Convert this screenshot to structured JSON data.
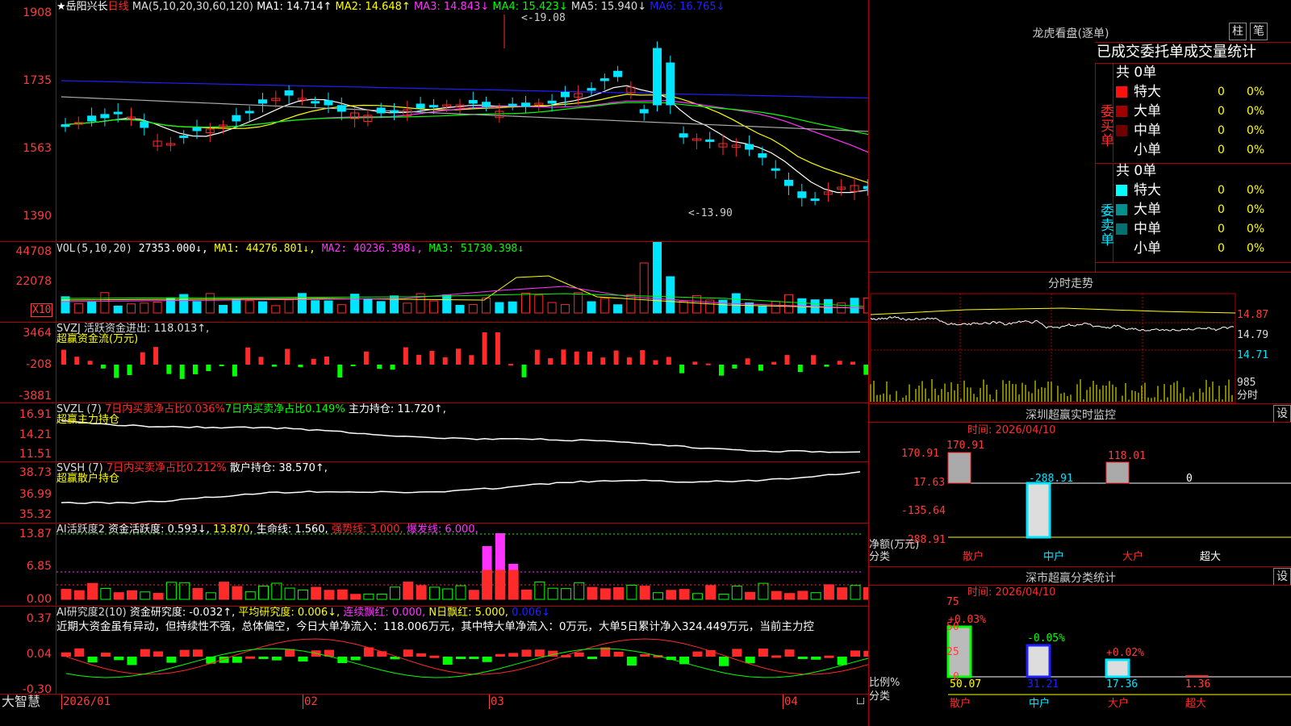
{
  "colors": {
    "up": "#ff2a2a",
    "down": "#00e5ff",
    "ma1": "#ffffff",
    "ma2": "#ffff00",
    "ma3": "#ff33ff",
    "ma4": "#00ff00",
    "ma5": "#aaaaaa",
    "ma6": "#2020ff",
    "grid": "#b00000",
    "vol_ma3": "#00ff00"
  },
  "header": {
    "stock_name": "★岳阳兴长",
    "period": "日线",
    "ma_label": "MA(5,10,20,30,60,120)",
    "ma1": "MA1: 14.714↑",
    "ma2": "MA2: 14.648↑",
    "ma3": "MA3: 14.843↓",
    "ma4": "MA4: 15.423↓",
    "ma5": "MA5: 15.940↓",
    "ma6": "MA6: 16.765↓"
  },
  "price_axis": [
    "1908",
    "1735",
    "1563",
    "1390"
  ],
  "price_annotations": {
    "high": "19.08",
    "low": "13.90"
  },
  "vol": {
    "label": "VOL(5,10,20)",
    "value": "27353.000↓,",
    "ma1": "MA1: 44276.801↓,",
    "ma2": "MA2: 40236.398↓,",
    "ma3": "MA3: 51730.398↓",
    "axis": [
      "44708",
      "22078"
    ],
    "unit": "X10"
  },
  "svzj": {
    "label": "SVZJ  活跃资金进出: 118.013↑,",
    "sub": "超赢资金流(万元)",
    "axis": [
      "3464",
      "-208",
      "-3881"
    ]
  },
  "svzl": {
    "label": "SVZL (7)",
    "t1": "7日内买卖净占比0.036%",
    "t2": "7日内买卖净占比0.149%",
    "t3": "主力持仓: 11.720↑,",
    "sub": "超赢主力持仓",
    "axis": [
      "16.91",
      "14.21",
      "11.51"
    ]
  },
  "svsh": {
    "label": "SVSH (7)",
    "t1": "7日内买卖净占比0.212%",
    "t2": "散户持仓: 38.570↑,",
    "sub": "超赢散户持仓",
    "axis": [
      "38.73",
      "36.99",
      "35.32"
    ]
  },
  "ai1": {
    "label": "AI活跃度2",
    "t1": "资金活跃度: 0.593↓,",
    "t2": "13.870,",
    "t3": "生命线: 1.560,",
    "t4": "强势线: 3.000,",
    "t5": "爆发线: 6.000,",
    "axis": [
      "13.87",
      "6.85",
      "0.00"
    ]
  },
  "ai2": {
    "label": "AI研究度2(10)",
    "t1": "资金研究度: -0.032↑,",
    "t2": "平均研究度: 0.006↓,",
    "t3": "连续飘红: 0.000,",
    "t4": "N日飘红: 5.000,",
    "t5": "0.006↓",
    "comment": "近期大资金虽有异动，但持续性不强，总体偏空，今日大单净流入：118.006万元，其中特大单净流入：0万元，大单5日累计净入324.449万元，当前主力控",
    "axis": [
      "0.37",
      "0.04",
      "-0.30"
    ]
  },
  "xaxis": {
    "brand": "大智慧",
    "labels": [
      "2026/01",
      "02",
      "03",
      "04"
    ]
  },
  "right": {
    "dragon_title": "龙虎看盘(逐单)",
    "btn_bar": "柱",
    "btn_pen": "笔",
    "stats_title": "已成交委托单成交量统计",
    "buy_side": "委买单",
    "sell_side": "委卖单",
    "buy_total": "共 0单",
    "sell_total": "共 0单",
    "buy_rows": [
      {
        "name": "特大",
        "val": "0",
        "pct": "0%",
        "color": "#ff1010"
      },
      {
        "name": "大单",
        "val": "0",
        "pct": "0%",
        "color": "#a00000"
      },
      {
        "name": "中单",
        "val": "0",
        "pct": "0%",
        "color": "#700000"
      },
      {
        "name": "小单",
        "val": "0",
        "pct": "0%",
        "color": ""
      }
    ],
    "sell_rows": [
      {
        "name": "特大",
        "val": "0",
        "pct": "0%",
        "color": "#00ffff"
      },
      {
        "name": "大单",
        "val": "0",
        "pct": "0%",
        "color": "#009090"
      },
      {
        "name": "中单",
        "val": "0",
        "pct": "0%",
        "color": "#007070"
      },
      {
        "name": "小单",
        "val": "0",
        "pct": "0%",
        "color": ""
      }
    ],
    "intraday_title": "分时走势",
    "intraday_axis": [
      "14.87",
      "14.79",
      "14.71",
      "985",
      "分时"
    ],
    "sz_title": "深圳超赢实时监控",
    "btn_set": "设",
    "sz_time": "时间: 2026/04/10",
    "sz_axis": [
      "170.91",
      "17.63",
      "-135.64",
      "-288.91"
    ],
    "sz_values": [
      "170.91",
      "-288.91",
      "118.01",
      "0"
    ],
    "sz_ylabel": "净额(万元)",
    "sz_xlabel": "分类",
    "cat_labels": [
      "散户",
      "中户",
      "大户",
      "超大"
    ],
    "cls_title": "深市超赢分类统计",
    "cls_time": "时间: 2026/04/10",
    "cls_axis": [
      "75",
      "50",
      "25",
      "0"
    ],
    "cls_changes": [
      "+0.03%",
      "-0.05%",
      "+0.02%"
    ],
    "cls_values": [
      "50.07",
      "31.21",
      "17.36",
      "1.36"
    ],
    "cls_ylabel": "比例%",
    "cls_xlabel": "分类"
  }
}
